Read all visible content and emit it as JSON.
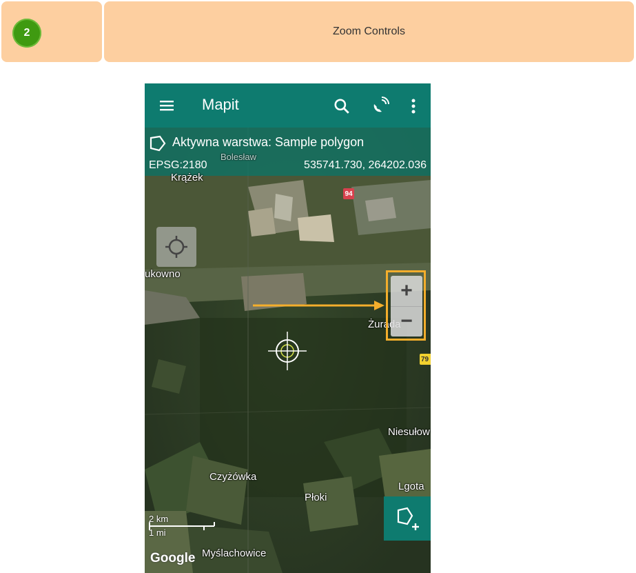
{
  "header": {
    "step_number": "2",
    "title": "Zoom Controls"
  },
  "app": {
    "title": "Mapit",
    "active_layer": "Aktywna warstwa: Sample polygon",
    "epsg": "EPSG:2180",
    "coordinates": "535741.730, 264202.036",
    "accent_color": "#0e7b6f",
    "highlight_color": "#f4ae2c"
  },
  "toolbar": {
    "menu_icon": "hamburger-menu-icon",
    "search_icon": "search-icon",
    "gps_icon": "gps-satellite-icon",
    "more_icon": "more-vert-icon"
  },
  "map": {
    "places": {
      "boleslaw": "Bolesław",
      "krazek": "Krążek",
      "bukowno": "ukowno",
      "zurada": "Żurada",
      "niesulowice": "Niesułow",
      "czyzowka": "Czyżówka",
      "ploki": "Płoki",
      "lgota": "Lgota",
      "myslachowice": "Myślachowice"
    },
    "road_94": "94",
    "road_791": "79",
    "scale_km": "2 km",
    "scale_mi": "1 mi",
    "attribution": "Google"
  },
  "zoom": {
    "in_label": "+",
    "out_label": "−"
  }
}
